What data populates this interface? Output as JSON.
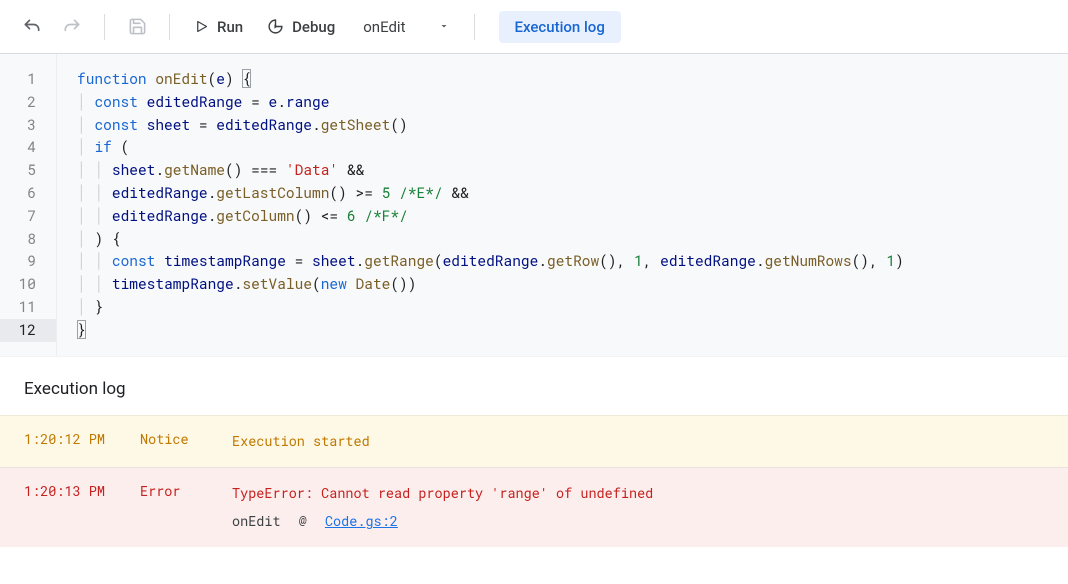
{
  "toolbar": {
    "run_label": "Run",
    "debug_label": "Debug",
    "function_selected": "onEdit",
    "exec_log_label": "Execution log"
  },
  "editor": {
    "lines": [
      "function onEdit(e) {",
      "  const editedRange = e.range",
      "  const sheet = editedRange.getSheet()",
      "  if (",
      "    sheet.getName() === 'Data' &&",
      "    editedRange.getLastColumn() >= 5 /*E*/ &&",
      "    editedRange.getColumn() <= 6 /*F*/",
      "  ) {",
      "    const timestampRange = sheet.getRange(editedRange.getRow(), 1, editedRange.getNumRows(), 1)",
      "    timestampRange.setValue(new Date())",
      "  }",
      "}"
    ],
    "line_count": 12,
    "current_line": 12
  },
  "log": {
    "title": "Execution log",
    "entries": [
      {
        "time": "1:20:12 PM",
        "level": "Notice",
        "kind": "notice",
        "message": "Execution started"
      },
      {
        "time": "1:20:13 PM",
        "level": "Error",
        "kind": "error",
        "message": "TypeError: Cannot read property 'range' of undefined",
        "stack_fn": "onEdit",
        "stack_at": "@",
        "stack_loc": "Code.gs:2"
      }
    ]
  }
}
